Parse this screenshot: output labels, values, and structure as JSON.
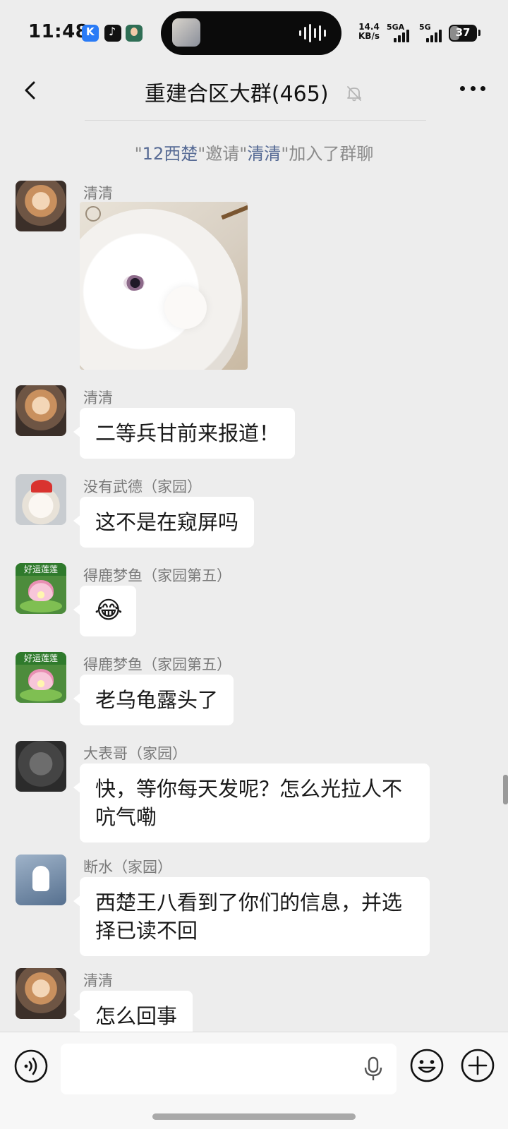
{
  "status_bar": {
    "time": "11:48",
    "net_speed_value": "14.4",
    "net_speed_unit": "KB/s",
    "signal_1_label": "5GA",
    "signal_2_label": "5G",
    "battery": "37"
  },
  "nav": {
    "title": "重建合区大群(465)",
    "muted": true
  },
  "system_message": {
    "inviter": "12西楚",
    "action": "邀请",
    "invitee": "清清",
    "suffix": "加入了群聊"
  },
  "messages": [
    {
      "sender": "清清",
      "type": "image",
      "avatar_icon": "kitten-avatar"
    },
    {
      "sender": "清清",
      "type": "text",
      "text": "二等兵甘前来报道！",
      "avatar_icon": "kitten-avatar"
    },
    {
      "sender": "没有武德（家园）",
      "type": "text",
      "text": "这不是在窥屏吗",
      "avatar_icon": "teddy-bear-avatar"
    },
    {
      "sender": "得鹿梦鱼（家园第五）",
      "type": "emoji",
      "text": "😂",
      "avatar_icon": "lotus-avatar",
      "avatar_banner": "好运莲莲"
    },
    {
      "sender": "得鹿梦鱼（家园第五）",
      "type": "text",
      "text": "老乌龟露头了",
      "avatar_icon": "lotus-avatar",
      "avatar_banner": "好运莲莲"
    },
    {
      "sender": "大表哥（家园）",
      "type": "text",
      "text": "快，等你每天发呢？怎么光拉人不吭气嘞",
      "avatar_icon": "grey-cat-avatar"
    },
    {
      "sender": "断水（家园）",
      "type": "text",
      "text": "西楚王八看到了你们的信息，并选择已读不回",
      "avatar_icon": "rainy-figure-avatar"
    },
    {
      "sender": "清清",
      "type": "text",
      "text": "怎么回事",
      "avatar_icon": "kitten-avatar"
    }
  ],
  "input": {
    "value": "",
    "placeholder": ""
  }
}
